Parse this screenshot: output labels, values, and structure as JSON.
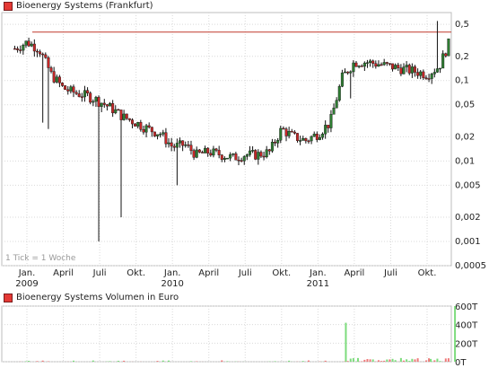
{
  "price_legend": "Bioenergy Systems (Frankfurt)",
  "volume_legend": "Bioenergy Systems Volumen in Euro",
  "tick_note": "1 Tick = 1 Woche",
  "colors": {
    "up": "#2e7d32",
    "down": "#c62828",
    "wick": "#111111",
    "resistance": "#c0392b",
    "grid": "#d9d9d9",
    "vol_up": "#7ddc7d",
    "vol_down": "#ef7a7a"
  },
  "chart_data": [
    {
      "type": "candlestick",
      "title": "Bioenergy Systems (Frankfurt)",
      "scale": "log",
      "y_ticks": [
        "0,5",
        "0,2",
        "0,1",
        "0,05",
        "0,02",
        "0,01",
        "0,005",
        "0,002",
        "0,001",
        "0,0005"
      ],
      "y_tick_values": [
        0.5,
        0.2,
        0.1,
        0.05,
        0.02,
        0.01,
        0.005,
        0.002,
        0.001,
        0.0005
      ],
      "x_ticks": [
        {
          "label": "Jan.",
          "sub": "2009"
        },
        {
          "label": "April",
          "sub": ""
        },
        {
          "label": "Juli",
          "sub": ""
        },
        {
          "label": "Okt.",
          "sub": ""
        },
        {
          "label": "Jan.",
          "sub": "2010"
        },
        {
          "label": "April",
          "sub": ""
        },
        {
          "label": "Juli",
          "sub": ""
        },
        {
          "label": "Okt.",
          "sub": ""
        },
        {
          "label": "Jan.",
          "sub": "2011"
        },
        {
          "label": "April",
          "sub": ""
        },
        {
          "label": "Juli",
          "sub": ""
        },
        {
          "label": "Okt.",
          "sub": ""
        }
      ],
      "resistance_level": 0.4,
      "period": "1 Tick = 1 Woche",
      "weekly_close_path": [
        [
          "2008-12",
          0.25
        ],
        [
          "2009-01",
          0.3
        ],
        [
          "2009-02",
          0.25
        ],
        [
          "2009-03",
          0.12
        ],
        [
          "2009-04",
          0.08
        ],
        [
          "2009-05",
          0.07
        ],
        [
          "2009-06",
          0.065
        ],
        [
          "2009-07",
          0.055
        ],
        [
          "2009-08",
          0.045
        ],
        [
          "2009-09",
          0.035
        ],
        [
          "2009-10",
          0.03
        ],
        [
          "2009-11",
          0.025
        ],
        [
          "2009-12",
          0.022
        ],
        [
          "2010-01",
          0.015
        ],
        [
          "2010-02",
          0.016
        ],
        [
          "2010-03",
          0.012
        ],
        [
          "2010-04",
          0.013
        ],
        [
          "2010-05",
          0.012
        ],
        [
          "2010-06",
          0.011
        ],
        [
          "2010-07",
          0.012
        ],
        [
          "2010-08",
          0.012
        ],
        [
          "2010-09",
          0.013
        ],
        [
          "2010-10",
          0.025
        ],
        [
          "2010-11",
          0.02
        ],
        [
          "2010-12",
          0.018
        ],
        [
          "2011-01",
          0.022
        ],
        [
          "2011-02",
          0.03
        ],
        [
          "2011-03",
          0.11
        ],
        [
          "2011-04",
          0.17
        ],
        [
          "2011-05",
          0.17
        ],
        [
          "2011-06",
          0.16
        ],
        [
          "2011-07",
          0.15
        ],
        [
          "2011-08",
          0.14
        ],
        [
          "2011-09",
          0.13
        ],
        [
          "2011-10",
          0.12
        ],
        [
          "2011-11",
          0.15
        ],
        [
          "2011-12",
          0.35
        ]
      ]
    },
    {
      "type": "bar",
      "title": "Bioenergy Systems Volumen in Euro",
      "y_ticks": [
        "600T",
        "400T",
        "200T",
        "0T"
      ],
      "y_tick_values": [
        600,
        400,
        200,
        0
      ],
      "ylim": [
        0,
        600
      ],
      "notable_bars": [
        [
          "2011-03",
          420
        ],
        [
          "2011-04",
          40
        ],
        [
          "2011-10",
          30
        ],
        [
          "2011-12",
          600
        ]
      ]
    }
  ]
}
